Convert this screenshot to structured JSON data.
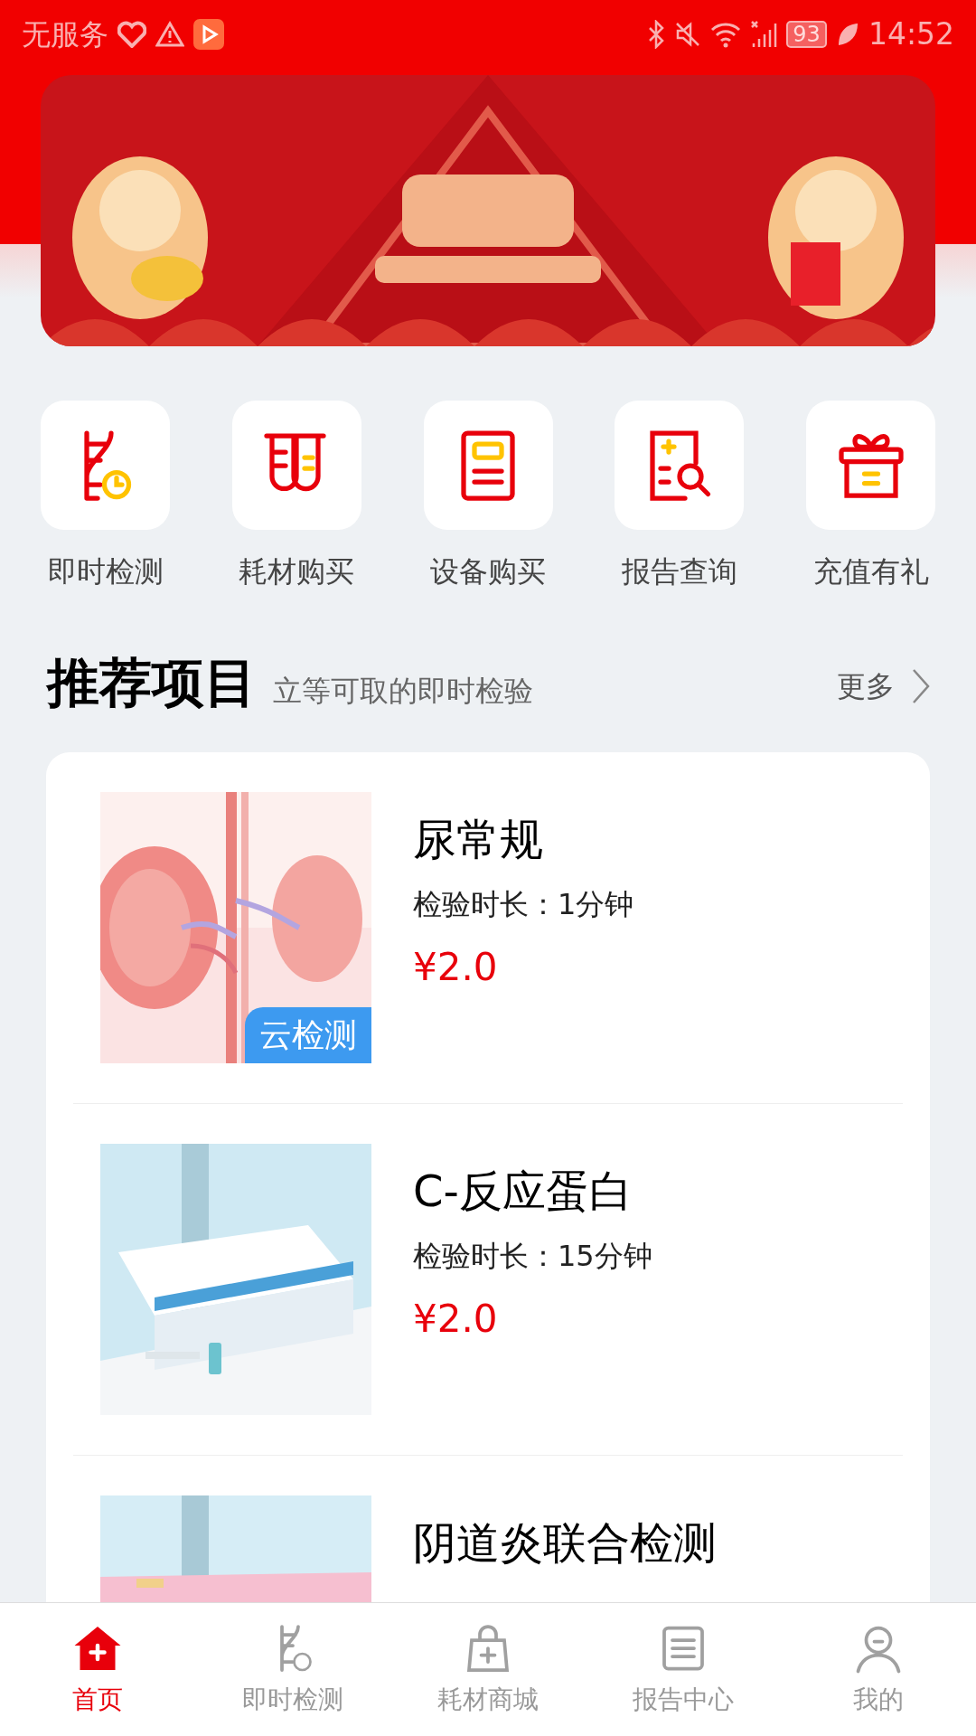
{
  "status_bar": {
    "carrier": "无服务",
    "battery": "93",
    "time": "14:52"
  },
  "shortcuts": [
    {
      "label": "即时检测"
    },
    {
      "label": "耗材购买"
    },
    {
      "label": "设备购买"
    },
    {
      "label": "报告查询"
    },
    {
      "label": "充值有礼"
    }
  ],
  "section": {
    "title": "推荐项目",
    "subtitle": "立等可取的即时检验",
    "more": "更多"
  },
  "products": [
    {
      "title": "尿常规",
      "duration": "检验时长：1分钟",
      "price": "¥2.0",
      "tag": "云检测"
    },
    {
      "title": "C-反应蛋白",
      "duration": "检验时长：15分钟",
      "price": "¥2.0"
    },
    {
      "title": "阴道炎联合检测"
    }
  ],
  "tab_bar": [
    {
      "label": "首页",
      "selected": true
    },
    {
      "label": "即时检测",
      "selected": false
    },
    {
      "label": "耗材商城",
      "selected": false
    },
    {
      "label": "报告中心",
      "selected": false
    },
    {
      "label": "我的",
      "selected": false
    }
  ]
}
